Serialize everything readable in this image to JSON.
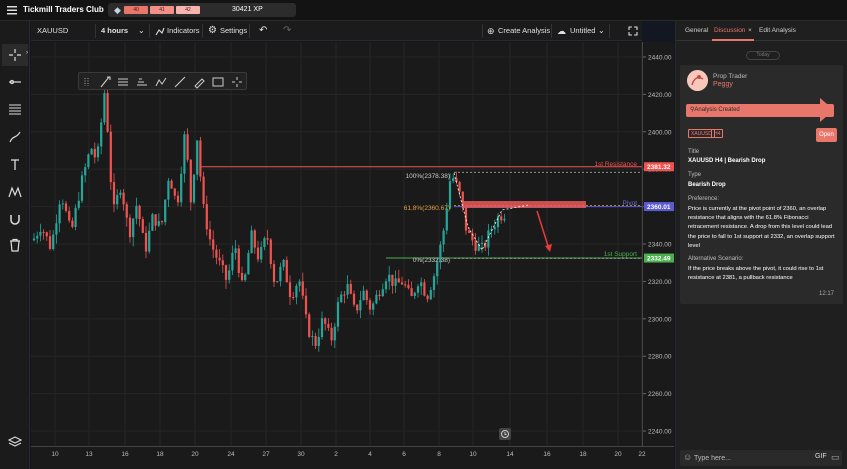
{
  "app": {
    "title": "Tickmill Traders Club"
  },
  "xp_bar": {
    "levels": [
      "40",
      "41",
      "42"
    ],
    "xp": "30421 XP"
  },
  "toolbar": {
    "symbol": "XAUUSD",
    "interval": "4 hours",
    "indicators_label": "Indicators",
    "settings_label": "Settings",
    "create_analysis_label": "Create Analysis",
    "layout_name": "Untitled"
  },
  "drawing_tools": [
    "cursor-icon",
    "brush-icon",
    "lines-icon",
    "channel-icon",
    "zigzag-icon",
    "ray-icon",
    "pen-icon",
    "rectangle-icon",
    "crosshair-icon"
  ],
  "left_tools": [
    "crosshair-icon",
    "trendline-icon",
    "fib-levels-icon",
    "brush-icon",
    "text-icon",
    "pattern-icon",
    "magnet-icon",
    "trash-icon",
    "layers-icon"
  ],
  "price_axis": {
    "ticks": [
      "2440.00",
      "2420.00",
      "2400.00",
      "2380.00",
      "2360.00",
      "2340.00",
      "2320.00",
      "2300.00",
      "2280.00",
      "2260.00",
      "2240.00"
    ],
    "markers": [
      {
        "label": "2381.32",
        "color": "#f0524f"
      },
      {
        "label": "2360.01",
        "color": "#5b5bd6"
      },
      {
        "label": "2332.49",
        "color": "#4caf50"
      }
    ]
  },
  "time_axis": {
    "ticks": [
      "10",
      "13",
      "16",
      "18",
      "20",
      "24",
      "27",
      "30",
      "2",
      "4",
      "6",
      "8",
      "10",
      "14",
      "16",
      "18",
      "20",
      "22"
    ]
  },
  "annotations": {
    "resistance": "1st Resistance",
    "pivot": "Pivot",
    "support": "1st Support",
    "fib_100": "100%(2378.38)",
    "fib_618": "61.8%(2360.67)",
    "fib_0": "0%(2332.38)"
  },
  "chart_data": {
    "type": "candlestick",
    "symbol": "XAUUSD",
    "interval": "4 hours",
    "ylim": [
      2232,
      2448
    ],
    "up_color": "#26a69a",
    "down_color": "#ef5350",
    "levels": [
      {
        "name": "1st Resistance",
        "value": 2381.32
      },
      {
        "name": "Pivot",
        "value": 2360.01
      },
      {
        "name": "1st Support",
        "value": 2332.49
      }
    ],
    "fibonacci": [
      {
        "label": "100%",
        "value": 2378.38
      },
      {
        "label": "61.8%",
        "value": 2360.67
      },
      {
        "label": "0%",
        "value": 2332.38
      }
    ]
  },
  "panel": {
    "tabs": [
      "General",
      "Discussion",
      "Edit Analysis"
    ],
    "active_tab": "Discussion",
    "today_label": "Today",
    "post": {
      "role": "Prop Trader",
      "user": "Peggy",
      "event": "Analysis Created",
      "tags": [
        "XAUUSD",
        "H4"
      ],
      "open_label": "Open",
      "title_label": "Title",
      "title": "XAUUSD H4 | Bearish Drop",
      "type_label": "Type",
      "type": "Bearish Drop",
      "preference_label": "Preference:",
      "preference": "Price is currently at the pivot point of 2360, an overlap resistance that aligns with the 61.8% Fibonacci retracement resistance. A drop from this level could lead the price to fall to 1st support at 2332, an overlap support level",
      "alt_label": "Alternative Scenario:",
      "alt": "If the price breaks above the pivot, it could rise to 1st resistance at 2381, a pullback resistance",
      "time": "12:17"
    },
    "reply_placeholder": "Type here...",
    "gif_label": "GIF"
  }
}
